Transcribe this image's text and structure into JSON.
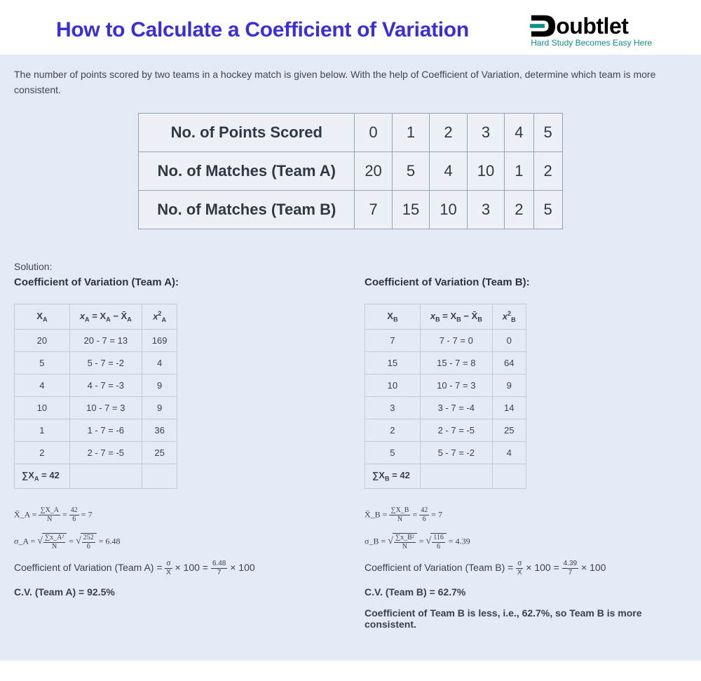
{
  "header": {
    "title": "How to Calculate a Coefficient of Variation",
    "logo_text": "oubtlet",
    "tagline": "Hard Study Becomes Easy Here"
  },
  "prompt": "The number of points scored by two teams in a hockey match is given below. With the help of Coefficient of Variation, determine which team is more consistent.",
  "data_table": {
    "rows": [
      {
        "label": "No. of Points Scored",
        "vals": [
          "0",
          "1",
          "2",
          "3",
          "4",
          "5"
        ]
      },
      {
        "label": "No. of Matches (Team A)",
        "vals": [
          "20",
          "5",
          "4",
          "10",
          "1",
          "2"
        ]
      },
      {
        "label": "No. of Matches (Team B)",
        "vals": [
          "7",
          "15",
          "10",
          "3",
          "2",
          "5"
        ]
      }
    ]
  },
  "solution_label": "Solution:",
  "teamA": {
    "heading": "Coefficient of Variation (Team A):",
    "h1": "X",
    "h1sub": "A",
    "h2": "x_A = X_A − X̄_A",
    "h3": "x",
    "h3sub": "A",
    "h3sup": "2",
    "rows": [
      {
        "x": "20",
        "d": "20 - 7 = 13",
        "sq": "169"
      },
      {
        "x": "5",
        "d": "5 - 7 = -2",
        "sq": "4"
      },
      {
        "x": "4",
        "d": "4 - 7 = -3",
        "sq": "9"
      },
      {
        "x": "10",
        "d": "10 - 7 = 3",
        "sq": "9"
      },
      {
        "x": "1",
        "d": "1 - 7 = -6",
        "sq": "36"
      },
      {
        "x": "2",
        "d": "2 - 7 = -5",
        "sq": "25"
      }
    ],
    "sum": "∑X_A = 42",
    "mean_lhs": "X̄_A =",
    "mean_f1n": "∑X_A",
    "mean_f1d": "N",
    "mean_f2n": "42",
    "mean_f2d": "6",
    "mean_rhs": "= 7",
    "sd_lhs": "σ_A =",
    "sd_f1n": "∑x_A²",
    "sd_f1d": "N",
    "sd_f2n": "252",
    "sd_f2d": "6",
    "sd_rhs": "= 6.48",
    "cv_text": "Coefficient of Variation (Team A) =",
    "cv_f1n": "σ",
    "cv_f1d": "X̄",
    "cv_mid": "× 100 =",
    "cv_f2n": "6.48",
    "cv_f2d": "7",
    "cv_end": "× 100",
    "result": "C.V. (Team A) = 92.5%"
  },
  "teamB": {
    "heading": "Coefficient of Variation (Team B):",
    "h1": "X",
    "h1sub": "B",
    "h2": "x_B = X_B − X̄_B",
    "h3": "x",
    "h3sub": "B",
    "h3sup": "2",
    "rows": [
      {
        "x": "7",
        "d": "7 - 7 = 0",
        "sq": "0"
      },
      {
        "x": "15",
        "d": "15 - 7 = 8",
        "sq": "64"
      },
      {
        "x": "10",
        "d": "10 - 7 = 3",
        "sq": "9"
      },
      {
        "x": "3",
        "d": "3 - 7 = -4",
        "sq": "14"
      },
      {
        "x": "2",
        "d": "2 - 7 = -5",
        "sq": "25"
      },
      {
        "x": "5",
        "d": "5 - 7 = -2",
        "sq": "4"
      }
    ],
    "sum": "∑X_B = 42",
    "mean_lhs": "X̄_B =",
    "mean_f1n": "∑X_B",
    "mean_f1d": "N",
    "mean_f2n": "42",
    "mean_f2d": "6",
    "mean_rhs": "= 7",
    "sd_lhs": "σ_B =",
    "sd_f1n": "∑x_B²",
    "sd_f1d": "N",
    "sd_f2n": "116",
    "sd_f2d": "6",
    "sd_rhs": "= 4.39",
    "cv_text": "Coefficient of Variation (Team B) =",
    "cv_f1n": "σ",
    "cv_f1d": "X̄",
    "cv_mid": "× 100 =",
    "cv_f2n": "4.39",
    "cv_f2d": "7",
    "cv_end": "× 100",
    "result": "C.V. (Team B) = 62.7%",
    "conclusion": "Coefficient of Team B is less, i.e., 62.7%, so Team B is more consistent."
  }
}
